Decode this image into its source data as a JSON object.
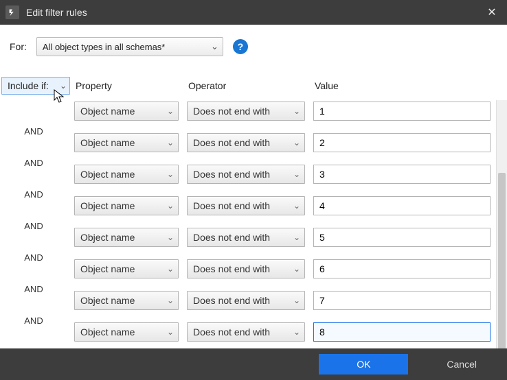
{
  "dialog": {
    "title": "Edit filter rules",
    "close_symbol": "✕"
  },
  "for": {
    "label": "For:",
    "selected": "All object types in all schemas*",
    "help_symbol": "?"
  },
  "rules": {
    "include_label": "Include if:",
    "join_label": "AND",
    "headers": {
      "property": "Property",
      "operator": "Operator",
      "value": "Value"
    },
    "rows": [
      {
        "property": "Object name",
        "operator": "Does not end with",
        "value": "1",
        "focused": false
      },
      {
        "property": "Object name",
        "operator": "Does not end with",
        "value": "2",
        "focused": false
      },
      {
        "property": "Object name",
        "operator": "Does not end with",
        "value": "3",
        "focused": false
      },
      {
        "property": "Object name",
        "operator": "Does not end with",
        "value": "4",
        "focused": false
      },
      {
        "property": "Object name",
        "operator": "Does not end with",
        "value": "5",
        "focused": false
      },
      {
        "property": "Object name",
        "operator": "Does not end with",
        "value": "6",
        "focused": false
      },
      {
        "property": "Object name",
        "operator": "Does not end with",
        "value": "7",
        "focused": false
      },
      {
        "property": "Object name",
        "operator": "Does not end with",
        "value": "8",
        "focused": true
      }
    ]
  },
  "footer": {
    "ok_label": "OK",
    "cancel_label": "Cancel"
  },
  "colors": {
    "accent": "#1a73e8",
    "danger": "#b22222"
  },
  "chevron": "⌄"
}
